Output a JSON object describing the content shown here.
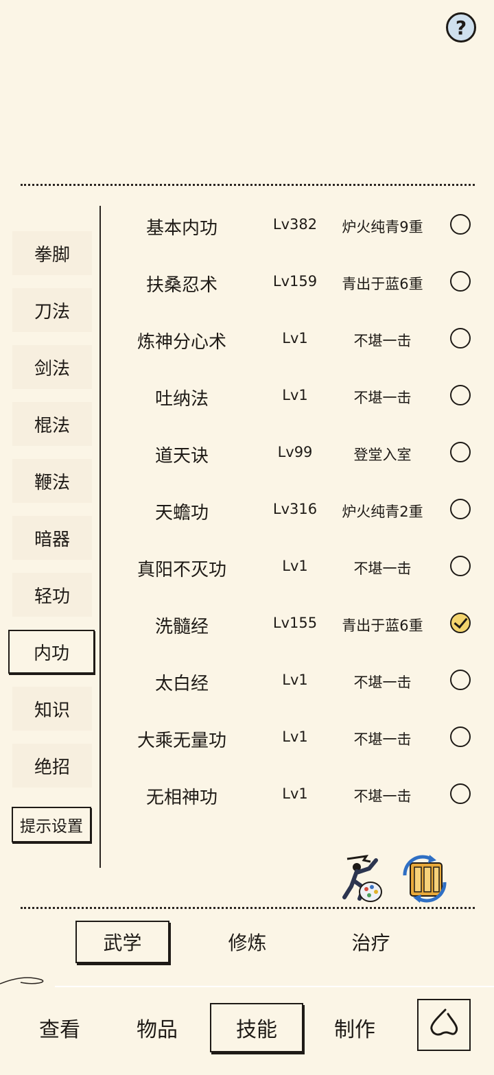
{
  "help": {
    "glyph": "?"
  },
  "categories": [
    {
      "label": "拳脚",
      "active": false
    },
    {
      "label": "刀法",
      "active": false
    },
    {
      "label": "剑法",
      "active": false
    },
    {
      "label": "棍法",
      "active": false
    },
    {
      "label": "鞭法",
      "active": false
    },
    {
      "label": "暗器",
      "active": false
    },
    {
      "label": "轻功",
      "active": false
    },
    {
      "label": "内功",
      "active": true
    },
    {
      "label": "知识",
      "active": false
    },
    {
      "label": "绝招",
      "active": false
    }
  ],
  "hint_button": "提示设置",
  "skills": [
    {
      "name": "基本内功",
      "level": "Lv382",
      "stage": "炉火纯青9重",
      "checked": false
    },
    {
      "name": "扶桑忍术",
      "level": "Lv159",
      "stage": "青出于蓝6重",
      "checked": false
    },
    {
      "name": "炼神分心术",
      "level": "Lv1",
      "stage": "不堪一击",
      "checked": false
    },
    {
      "name": "吐纳法",
      "level": "Lv1",
      "stage": "不堪一击",
      "checked": false
    },
    {
      "name": "道天诀",
      "level": "Lv99",
      "stage": "登堂入室",
      "checked": false
    },
    {
      "name": "天蟾功",
      "level": "Lv316",
      "stage": "炉火纯青2重",
      "checked": false
    },
    {
      "name": "真阳不灭功",
      "level": "Lv1",
      "stage": "不堪一击",
      "checked": false
    },
    {
      "name": "洗髓经",
      "level": "Lv155",
      "stage": "青出于蓝6重",
      "checked": true
    },
    {
      "name": "太白经",
      "level": "Lv1",
      "stage": "不堪一击",
      "checked": false
    },
    {
      "name": "大乘无量功",
      "level": "Lv1",
      "stage": "不堪一击",
      "checked": false
    },
    {
      "name": "无相神功",
      "level": "Lv1",
      "stage": "不堪一击",
      "checked": false
    }
  ],
  "tool_icons": [
    "martial-artist-palette-icon",
    "scroll-swap-icon"
  ],
  "sub_tabs": [
    {
      "label": "武学",
      "active": true
    },
    {
      "label": "修炼",
      "active": false
    },
    {
      "label": "治疗",
      "active": false
    }
  ],
  "nav_tabs": [
    {
      "label": "查看",
      "active": false
    },
    {
      "label": "物品",
      "active": false
    },
    {
      "label": "技能",
      "active": true
    },
    {
      "label": "制作",
      "active": false
    }
  ],
  "colors": {
    "background": "#fbf5e6",
    "ink": "#1e1a16",
    "check_fill": "#f3d46d",
    "help_fill": "#cfe0ee"
  }
}
